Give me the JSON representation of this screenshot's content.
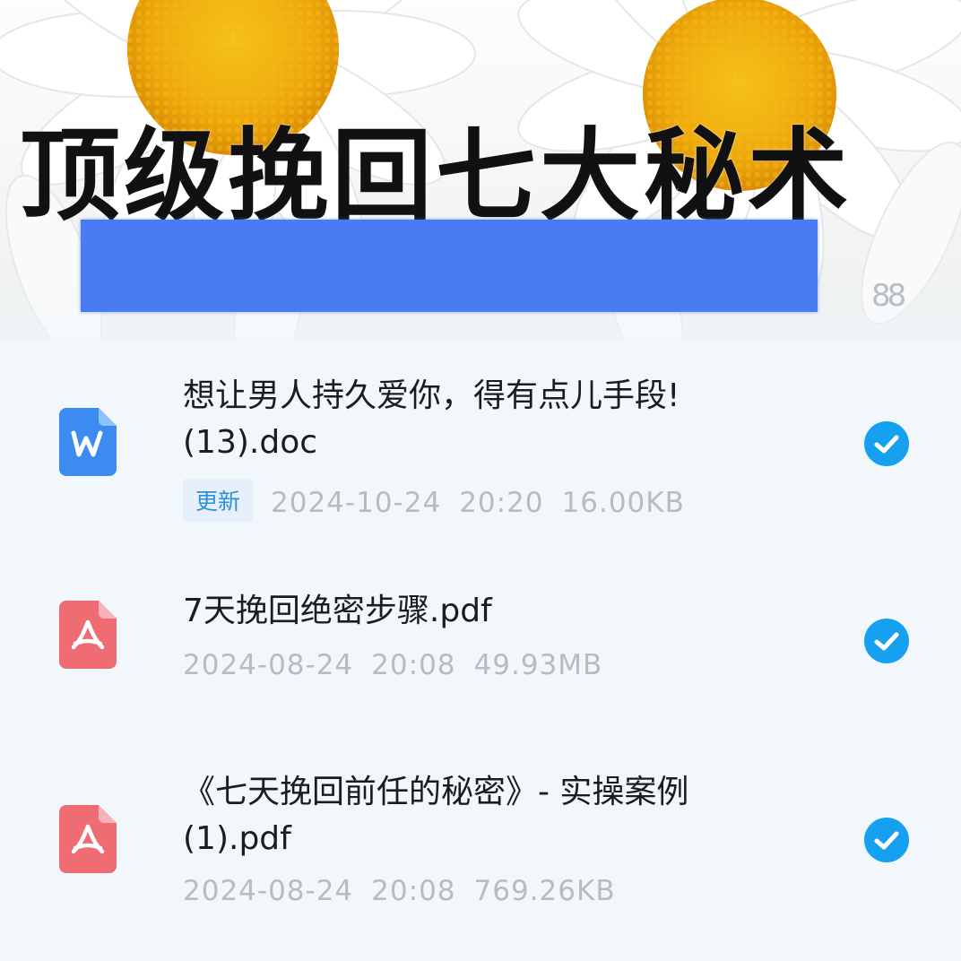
{
  "hero": {
    "title": "顶级挽回七大秘术",
    "corner_glyph": "88"
  },
  "files": [
    {
      "icon": "word-doc-icon",
      "name_line1": "想让男人持久爱你，得有点儿手段!",
      "name_line2": "(13).doc",
      "badge": "更新",
      "date": "2024-10-24",
      "time": "20:20",
      "size": "16.00KB",
      "selected": true
    },
    {
      "icon": "pdf-icon",
      "name_line1": "7天挽回绝密步骤.pdf",
      "name_line2": "",
      "date": "2024-08-24",
      "time": "20:08",
      "size": "49.93MB",
      "selected": true
    },
    {
      "icon": "pdf-icon",
      "name_line1": "《七天挽回前任的秘密》- 实操案例",
      "name_line2": "(1).pdf",
      "date": "2024-08-24",
      "time": "20:08",
      "size": "769.26KB",
      "selected": true
    }
  ],
  "colors": {
    "word_icon": "#3b8bf0",
    "pdf_icon": "#ef6d72",
    "check": "#16a0f0",
    "badge_text": "#2c8fd8",
    "meta_text": "#b7bcc4",
    "highlight_bar": "#4a7bf2"
  }
}
